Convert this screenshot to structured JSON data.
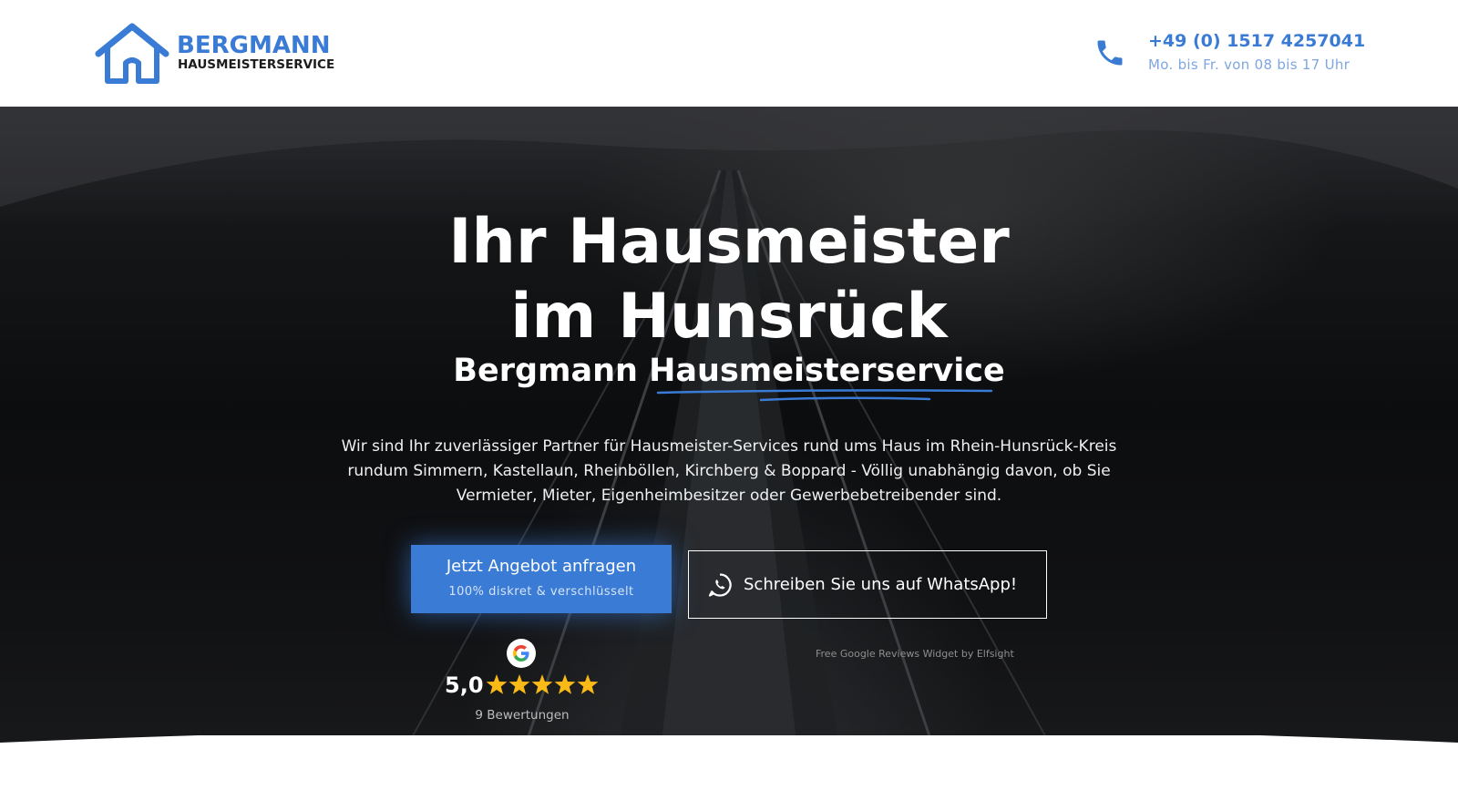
{
  "header": {
    "logo": {
      "name": "BERGMANN",
      "sub": "HAUSMEISTERSERVICE"
    },
    "contact": {
      "phone": "+49 (0) 1517 4257041",
      "hours": "Mo. bis Fr. von 08 bis 17 Uhr"
    }
  },
  "hero": {
    "title_line1": "Ihr Hausmeister",
    "title_line2": "im Hunsrück",
    "subtitle_prefix": "Bergmann",
    "subtitle_highlight": "Hausmeisterservice",
    "description": "Wir sind Ihr zuverlässiger Partner für Hausmeister-Services rund ums Haus im Rhein-Hunsrück-Kreis rundum Simmern, Kastellaun, Rheinböllen, Kirchberg & Boppard - Völlig unabhängig davon, ob Sie Vermieter, Mieter, Eigenheimbesitzer oder Gewerbebetreibender sind.",
    "cta_primary": {
      "label": "Jetzt Angebot anfragen",
      "note": "100% diskret & verschlüsselt"
    },
    "cta_whatsapp": {
      "label": "Schreiben Sie uns auf WhatsApp!"
    },
    "review": {
      "rating": "5,0",
      "stars": 5,
      "count": "9 Bewertungen"
    },
    "widget_credit": "Free Google Reviews Widget by Elfsight"
  },
  "colors": {
    "brand_blue": "#3a7bd5",
    "star_gold": "#f9b916",
    "dark": "#1c1c1c"
  },
  "icons": [
    "house-logo-icon",
    "phone-icon",
    "whatsapp-icon",
    "google-icon",
    "star-icon"
  ]
}
